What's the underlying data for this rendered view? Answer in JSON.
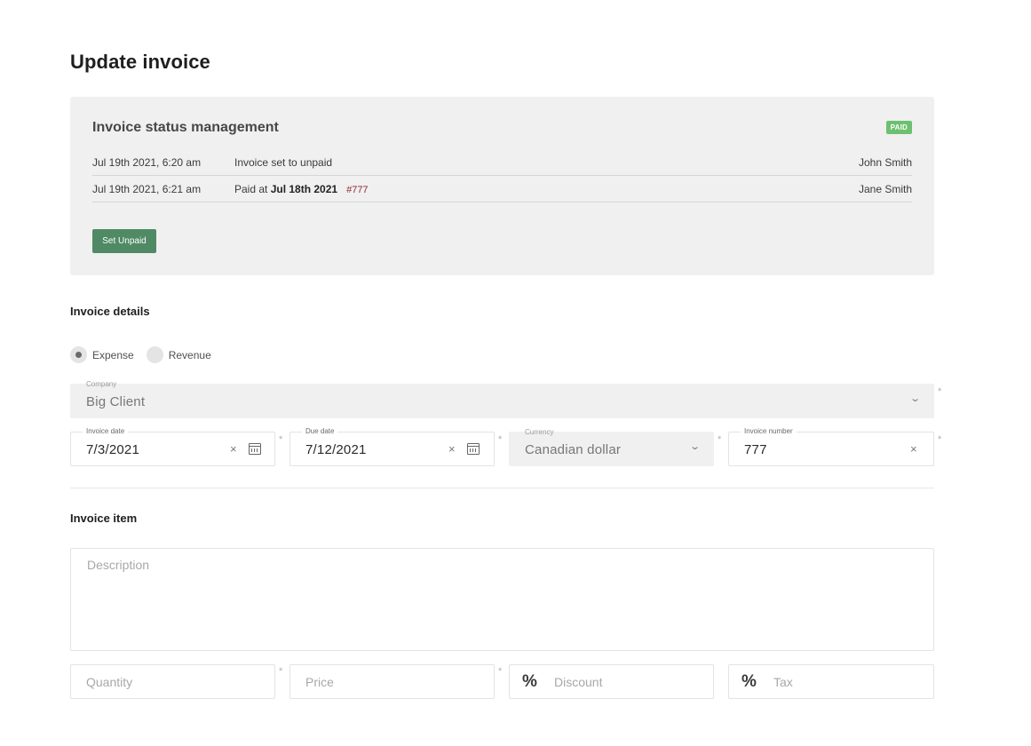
{
  "page": {
    "title": "Update invoice"
  },
  "status_panel": {
    "title": "Invoice status management",
    "badge": "PAID",
    "log": [
      {
        "date": "Jul 19th 2021, 6:20 am",
        "message": "Invoice set to unpaid",
        "user": "John Smith"
      },
      {
        "date": "Jul 19th 2021, 6:21 am",
        "message_prefix": "Paid at ",
        "message_bold": "Jul 18th 2021",
        "reference": "#777",
        "user": "Jane Smith"
      }
    ],
    "set_unpaid_label": "Set Unpaid"
  },
  "details": {
    "title": "Invoice details",
    "type_options": [
      {
        "label": "Expense",
        "selected": true
      },
      {
        "label": "Revenue",
        "selected": false
      }
    ],
    "company": {
      "label": "Company",
      "value": "Big Client"
    },
    "invoice_date": {
      "label": "Invoice date",
      "value": "7/3/2021"
    },
    "due_date": {
      "label": "Due date",
      "value": "7/12/2021"
    },
    "currency": {
      "label": "Currency",
      "value": "Canadian dollar"
    },
    "invoice_number": {
      "label": "Invoice number",
      "value": "777"
    },
    "required_mark": "*"
  },
  "item": {
    "title": "Invoice item",
    "description_placeholder": "Description",
    "quantity_placeholder": "Quantity",
    "price_placeholder": "Price",
    "discount_placeholder": "Discount",
    "tax_placeholder": "Tax",
    "percent_symbol": "%"
  },
  "icons": {
    "clear": "×",
    "chevron": "⌄"
  },
  "colors": {
    "paid_badge": "#6cc070",
    "set_unpaid_button": "#4f8a65",
    "panel_bg": "#f0f0f0",
    "reference": "#8b2b3a"
  }
}
